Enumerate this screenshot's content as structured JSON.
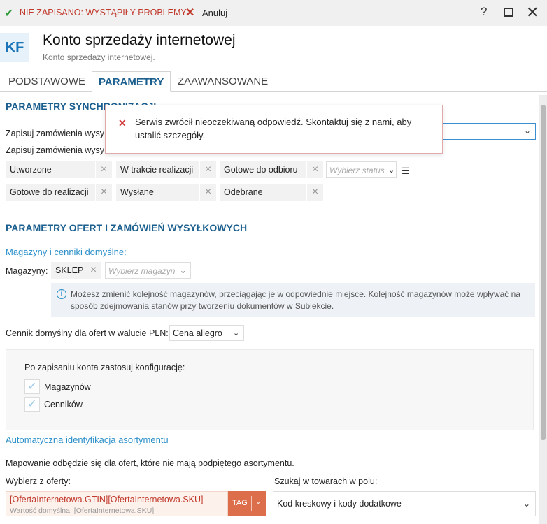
{
  "titlebar": {
    "status_label": "NIE ZAPISANO: WYSTĄPIŁY PROBLEMY",
    "cancel_label": "Anuluj",
    "help_glyph": "?",
    "close_glyph": "✕",
    "check_glyph": "✔",
    "cancel_glyph": "✕"
  },
  "header": {
    "avatar": "KF",
    "title": "Konto sprzedaży internetowej",
    "subtitle": "Konto sprzedaży internetowej."
  },
  "tabs": [
    {
      "label": "PODSTAWOWE",
      "active": false
    },
    {
      "label": "PARAMETRY",
      "active": true
    },
    {
      "label": "ZAAWANSOWANE",
      "active": false
    }
  ],
  "sync": {
    "title": "PARAMETRY SYNCHRONIZACJI",
    "row1_label": "Zapisuj zamówienia wysy",
    "row2_label": "Zapisuj zamówienia wysy",
    "statuses": [
      "Utworzone",
      "W trakcie realizacji",
      "Gotowe do odbioru",
      "Gotowe do realizacji",
      "Wysłane",
      "Odebrane"
    ],
    "status_placeholder": "Wybierz status"
  },
  "error_popup": {
    "message": "Serwis zwrócił nieoczekiwaną odpowiedź. Skontaktuj się z nami, aby ustalić szczegóły."
  },
  "offers": {
    "title": "PARAMETRY OFERT I ZAMÓWIEŃ WYSYŁKOWYCH",
    "warehouses_link": "Magazyny i cenniki domyślne:",
    "warehouses_label": "Magazyny:",
    "warehouse_chip": "SKLEP",
    "warehouse_placeholder": "Wybierz magazyn",
    "info_text": "Możesz zmienić kolejność magazynów, przeciągając je w odpowiednie miejsce. Kolejność magazynów może wpływać na sposób zdejmowania stanów przy tworzeniu dokumentów w Subiekcie.",
    "price_label": "Cennik domyślny dla ofert w walucie PLN:",
    "price_value": "Cena allegro",
    "config_label": "Po zapisaniu konta zastosuj konfigurację:",
    "config_options": [
      "Magazynów",
      "Cenników"
    ],
    "auto_link": "Automatyczna identyfikacja asortymentu",
    "mapping_text": "Mapowanie odbędzie się dla ofert, które nie mają podpiętego asortymentu.",
    "choose_label": "Wybierz z oferty:",
    "choose_value": "[OfertaInternetowa.GTIN][OfertaInternetowa.SKU]",
    "choose_default": "Wartość domyślna: [OfertaInternetowa.SKU]",
    "tag_label": "TAG",
    "search_label": "Szukaj w towarach w polu:",
    "search_value": "Kod kreskowy i kody dodatkowe"
  },
  "colors": {
    "accent": "#1b5f8f",
    "link": "#2b8fc9",
    "error": "#c0392b",
    "tag": "#dc6e4b"
  }
}
